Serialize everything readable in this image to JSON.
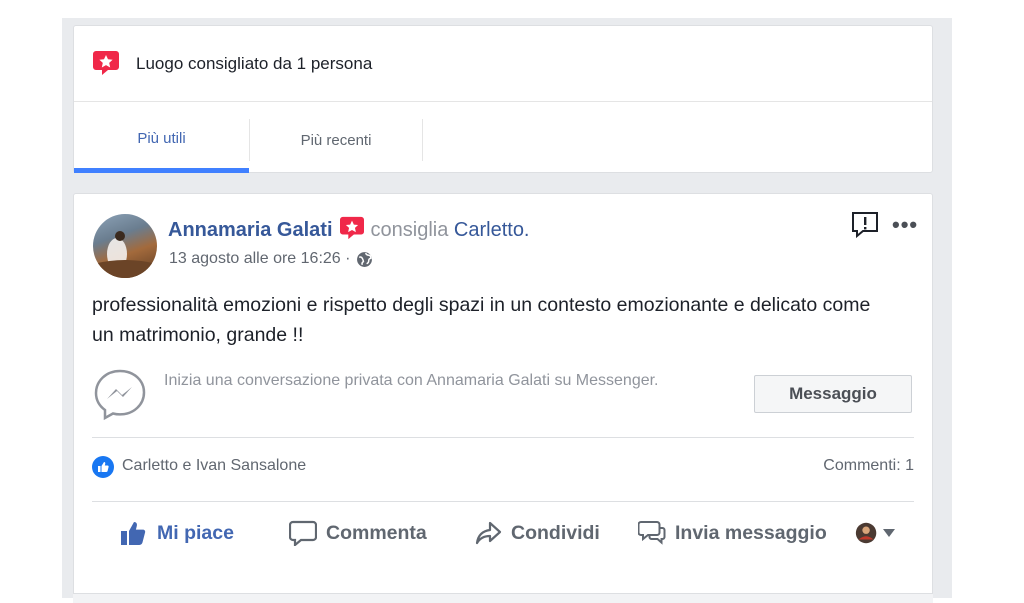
{
  "recommendation": {
    "text": "Luogo consigliato da 1 persona"
  },
  "tabs": [
    {
      "label": "Più utili",
      "active": true
    },
    {
      "label": "Più recenti",
      "active": false
    }
  ],
  "post": {
    "author": "Annamaria Galati",
    "verb": "consiglia",
    "page": "Carletto.",
    "date": "13 agosto alle ore 16:26 ·",
    "text": "professionalità emozioni e rispetto degli spazi in un contesto emozionante e delicato come un matrimonio, grande !!",
    "messenger_prompt": "Inizia una conversazione privata con Annamaria Galati su Messenger.",
    "message_button": "Messaggio",
    "reactions": "Carletto e Ivan Sansalone",
    "comments_count": "Commenti: 1"
  },
  "actions": {
    "like": "Mi piace",
    "comment": "Commenta",
    "share": "Condividi",
    "send": "Invia messaggio"
  },
  "colors": {
    "accent": "#4267b2",
    "recommend_red": "#f02849",
    "tab_indicator": "#4080ff"
  }
}
